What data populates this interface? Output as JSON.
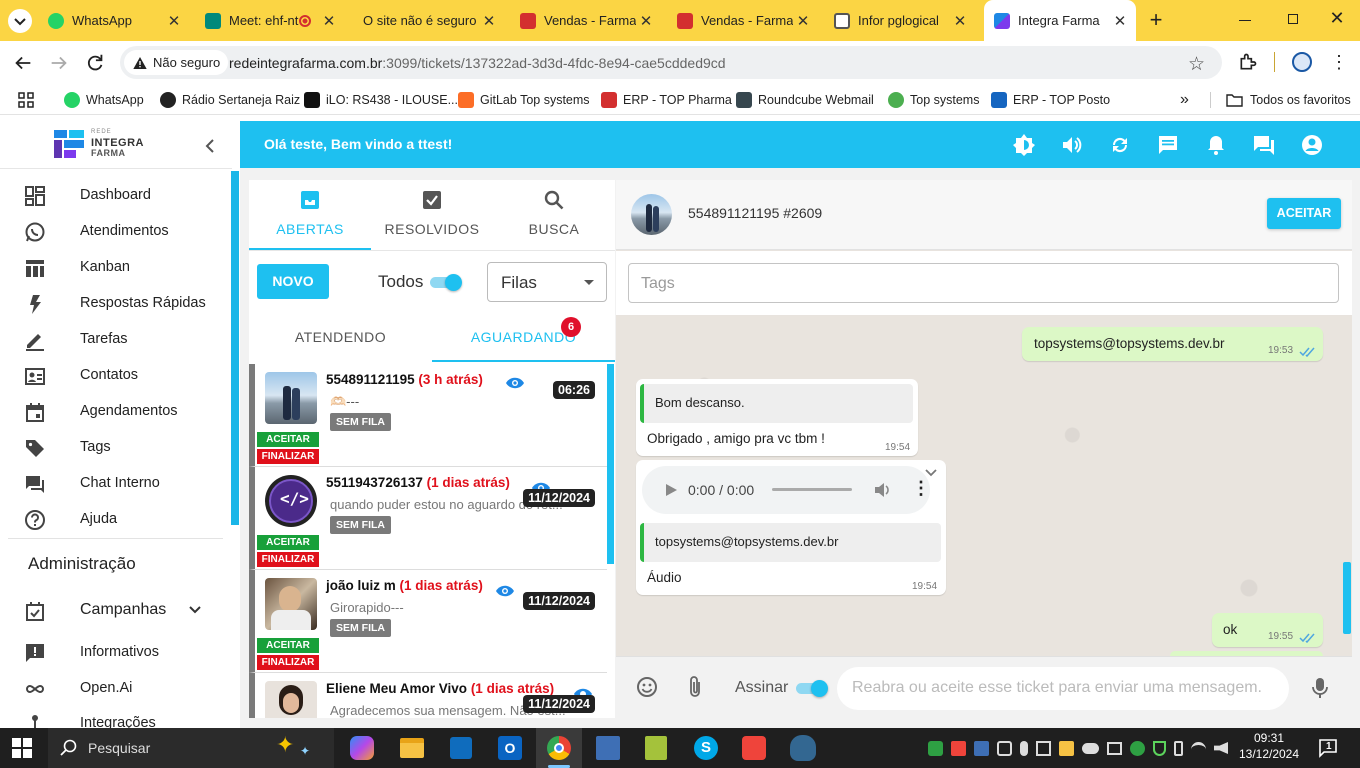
{
  "browser": {
    "tabs": [
      {
        "title": "WhatsApp",
        "icon": "whatsapp-icon",
        "color": "#25d366"
      },
      {
        "title": "Meet: ehf-nt",
        "icon": "google-meet-icon",
        "color": "#00897b"
      },
      {
        "title": "O site não é seguro",
        "icon": "warning-icon",
        "color": "#000000"
      },
      {
        "title": "Vendas - Farmac",
        "icon": "top-pharma-icon",
        "color": "#d32f2f"
      },
      {
        "title": "Vendas - Farmac",
        "icon": "top-pharma-icon",
        "color": "#d32f2f"
      },
      {
        "title": "Infor pglogical",
        "icon": "image-icon",
        "color": "#555555"
      },
      {
        "title": "Integra Farma",
        "icon": "integra-farma-icon",
        "color": "#1e88e5"
      }
    ],
    "security_label": "Não seguro",
    "url_host": "redeintegrafarma.com.br",
    "url_rest": ":3099/tickets/137322ad-3d3d-4fdc-8e94-cae5cdded9cd",
    "bookmarks": [
      {
        "label": "WhatsApp",
        "color": "#25d366"
      },
      {
        "label": "Rádio Sertaneja Raiz",
        "color": "#222222"
      },
      {
        "label": "iLO: RS438 - ILOUSE...",
        "color": "#111111"
      },
      {
        "label": "GitLab Top systems",
        "color": "#fc6d26"
      },
      {
        "label": "ERP - TOP Pharma",
        "color": "#d32f2f"
      },
      {
        "label": "Roundcube Webmail",
        "color": "#37474f"
      },
      {
        "label": "Top systems",
        "color": "#4caf50"
      },
      {
        "label": "ERP - TOP Posto",
        "color": "#1565c0"
      }
    ],
    "all_favorites": "Todos os favoritos"
  },
  "app": {
    "logo_small": "REDE",
    "logo_line1": "INTEGRA",
    "logo_line2": "FARMA",
    "welcome": "Olá teste, Bem vindo a ttest!",
    "nav": [
      {
        "label": "Dashboard",
        "icon": "dashboard-icon"
      },
      {
        "label": "Atendimentos",
        "icon": "whatsapp-icon"
      },
      {
        "label": "Kanban",
        "icon": "kanban-icon"
      },
      {
        "label": "Respostas Rápidas",
        "icon": "flash-icon"
      },
      {
        "label": "Tarefas",
        "icon": "pencil-icon"
      },
      {
        "label": "Contatos",
        "icon": "contacts-icon"
      },
      {
        "label": "Agendamentos",
        "icon": "calendar-icon"
      },
      {
        "label": "Tags",
        "icon": "tag-icon"
      },
      {
        "label": "Chat Interno",
        "icon": "chat-icon"
      },
      {
        "label": "Ajuda",
        "icon": "help-icon"
      }
    ],
    "admin_heading": "Administração",
    "admin_nav": [
      {
        "label": "Campanhas",
        "icon": "campaign-icon"
      },
      {
        "label": "Informativos",
        "icon": "announcement-icon"
      },
      {
        "label": "Open.Ai",
        "icon": "infinity-icon"
      },
      {
        "label": "Integrações",
        "icon": "integration-icon"
      }
    ]
  },
  "tickets": {
    "tabs": [
      {
        "label": "ABERTAS",
        "icon": "inbox-icon"
      },
      {
        "label": "RESOLVIDOS",
        "icon": "check-box-icon"
      },
      {
        "label": "BUSCA",
        "icon": "search-icon"
      }
    ],
    "new_button": "NOVO",
    "todos_label": "Todos",
    "filas_label": "Filas",
    "subtabs": [
      "ATENDENDO",
      "AGUARDANDO"
    ],
    "waiting_count": "6",
    "accept_label": "ACEITAR",
    "finish_label": "FINALIZAR",
    "no_queue_label": "SEM FILA",
    "items": [
      {
        "name": "554891121195",
        "ago": "(3 h atrás)",
        "message": "🫶🏻---",
        "time": "06:26"
      },
      {
        "name": "5511943726137",
        "ago": "(1 dias atrás)",
        "message": "quando puder estou no aguardo do ret...",
        "time": "11/12/2024"
      },
      {
        "name": "joão luiz m",
        "ago": "(1 dias atrás)",
        "message": "Girorapido---",
        "time": "11/12/2024"
      },
      {
        "name": "Eliene Meu Amor Vivo",
        "ago": "(1 dias atrás)",
        "message": "Agradecemos sua mensagem. Não est...",
        "time": "11/12/2024"
      }
    ]
  },
  "chat": {
    "contact": "554891121195 #2609",
    "accept_button": "ACEITAR",
    "tags_placeholder": "Tags",
    "messages": {
      "m1_text": "topsystems@topsystems.dev.br",
      "m1_time": "19:53",
      "m2_quote": "Bom descanso.",
      "m2_text": "Obrigado , amigo pra vc tbm !",
      "m2_time": "19:54",
      "audio_time": "0:00 / 0:00",
      "m3_quote": "topsystems@topsystems.dev.br",
      "m3_text": "Áudio",
      "m3_time": "19:54",
      "m4_text": "ok",
      "m4_time": "19:55"
    },
    "sign_label": "Assinar",
    "input_placeholder": "Reabra ou aceite esse ticket para enviar uma mensagem."
  },
  "taskbar": {
    "search_placeholder": "Pesquisar",
    "time": "09:31",
    "date": "13/12/2024",
    "notification_count": "1"
  }
}
